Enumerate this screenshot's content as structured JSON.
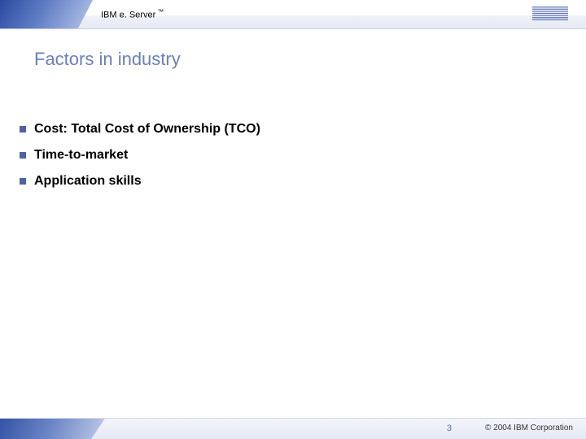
{
  "header": {
    "product": "IBM e. Server",
    "trademark": "™"
  },
  "slide": {
    "title": "Factors in industry",
    "bullets": [
      "Cost: Total Cost of Ownership (TCO)",
      "Time-to-market",
      "Application skills"
    ]
  },
  "footer": {
    "page": "3",
    "copyright": "© 2004 IBM Corporation"
  }
}
